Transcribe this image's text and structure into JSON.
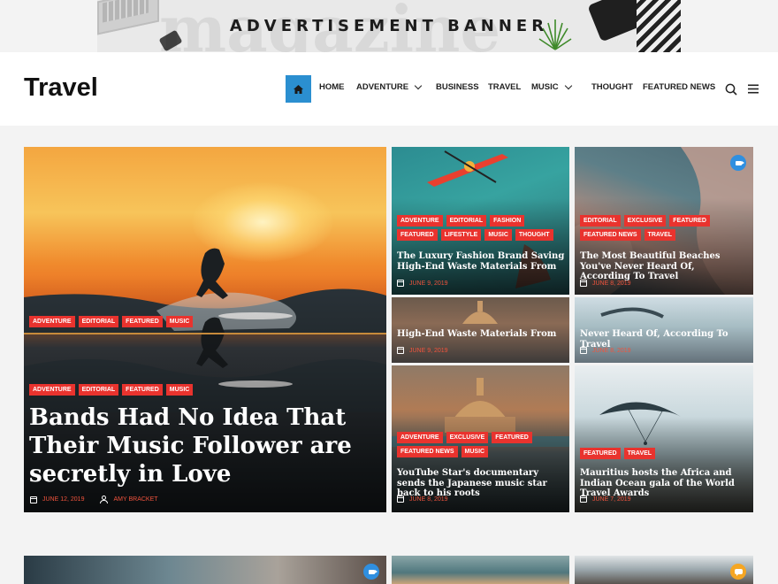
{
  "ad": {
    "text": "ADVERTISEMENT BANNER",
    "watermark": "magazine"
  },
  "header": {
    "site_title": "Travel",
    "nav": [
      {
        "label": "HOME",
        "dropdown": false
      },
      {
        "label": "ADVENTURE",
        "dropdown": true
      },
      {
        "label": "BUSINESS",
        "dropdown": false
      },
      {
        "label": "TRAVEL",
        "dropdown": false
      },
      {
        "label": "MUSIC",
        "dropdown": true
      },
      {
        "label": "THOUGHT",
        "dropdown": false
      },
      {
        "label": "FEATURED NEWS",
        "dropdown": false
      }
    ],
    "icons": [
      "home-icon",
      "search-icon",
      "menu-icon"
    ],
    "accent": "#2b8fd0"
  },
  "colors": {
    "tag": "#e9332e",
    "meta": "#f0533d",
    "video_badge": "#2f8fe0",
    "chat_badge": "#f5a623"
  },
  "hero": {
    "tags_top": [
      "ADVENTURE",
      "EDITORIAL",
      "FEATURED",
      "MUSIC"
    ],
    "tags": [
      "ADVENTURE",
      "EDITORIAL",
      "FEATURED",
      "MUSIC"
    ],
    "title": "Bands Had No Idea That Their Music Follower are secretly in Love",
    "date": "JUNE 12, 2019",
    "author": "AMY BRACKET"
  },
  "cards": [
    {
      "id": "kayak",
      "tags": [
        "ADVENTURE",
        "EDITORIAL",
        "FASHION",
        "FEATURED",
        "LIFESTYLE",
        "MUSIC",
        "THOUGHT"
      ],
      "title": "The Luxury Fashion Brand Saving High-End Waste Materials From",
      "date": "JUNE 9, 2019"
    },
    {
      "id": "beach",
      "tags": [
        "EDITORIAL",
        "EXCLUSIVE",
        "FEATURED",
        "FEATURED NEWS",
        "TRAVEL"
      ],
      "title": "The Most Beautiful Beaches You've Never Heard Of, According To Travel",
      "date": "JUNE 8, 2019",
      "badge": "video-icon"
    },
    {
      "id": "kayak-overlap",
      "title_fragment": "High-End Waste Materials From",
      "date": "JUNE 9, 2019"
    },
    {
      "id": "beach-overlap",
      "title_fragment": "Never Heard Of, According To Travel",
      "date": "JUNE 8, 2019"
    },
    {
      "id": "budapest",
      "tags": [
        "ADVENTURE",
        "EXCLUSIVE",
        "FEATURED",
        "FEATURED NEWS",
        "MUSIC"
      ],
      "title": "YouTube Star's documentary sends the Japanese music star back to his roots",
      "date": "JUNE 8, 2019"
    },
    {
      "id": "paraglide",
      "tags": [
        "FEATURED",
        "TRAVEL"
      ],
      "title": "Mauritius hosts the Africa and Indian Ocean gala of the World Travel Awards",
      "date": "JUNE 7, 2019"
    }
  ],
  "bottom_badges": [
    "video-icon",
    "chat-icon"
  ]
}
